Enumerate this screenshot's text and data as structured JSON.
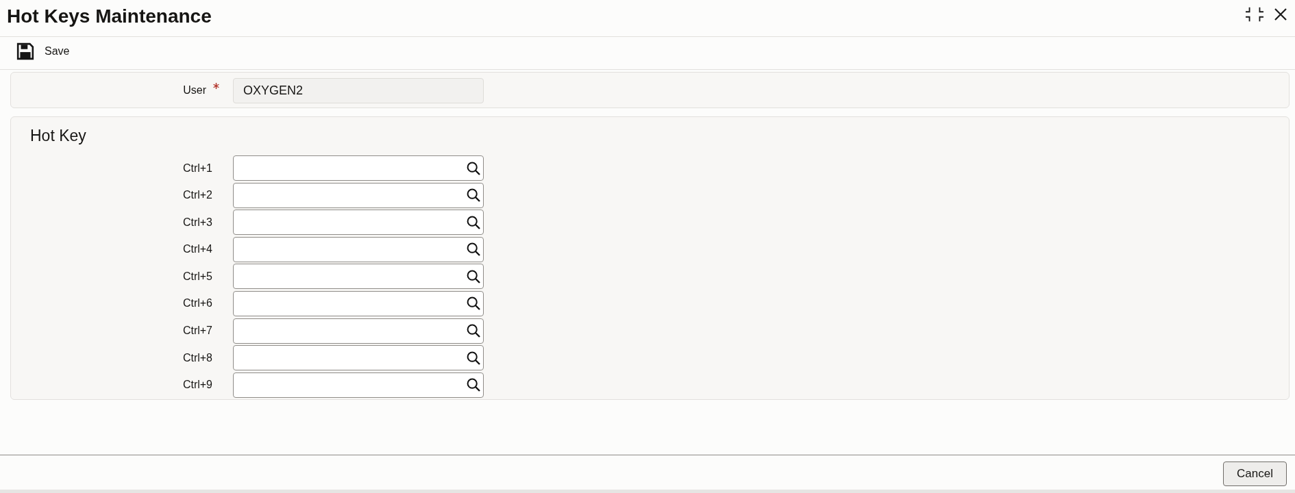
{
  "window": {
    "title": "Hot Keys Maintenance"
  },
  "toolbar": [
    {
      "label": "Save",
      "kind": "save"
    }
  ],
  "user_section": {
    "label": "User",
    "required": true,
    "readonly": true,
    "value": "OXYGEN2"
  },
  "hot_key": {
    "title": "Hot Key",
    "fields": [
      {
        "label": "Ctrl+1"
      },
      {
        "label": "Ctrl+2"
      },
      {
        "label": "Ctrl+3"
      },
      {
        "label": "Ctrl+4"
      },
      {
        "label": "Ctrl+5"
      },
      {
        "label": "Ctrl+6"
      },
      {
        "label": "Ctrl+7"
      },
      {
        "label": "Ctrl+8"
      },
      {
        "label": "Ctrl+9"
      }
    ]
  },
  "footer": {
    "buttons": [
      {
        "label": "Cancel"
      }
    ]
  }
}
